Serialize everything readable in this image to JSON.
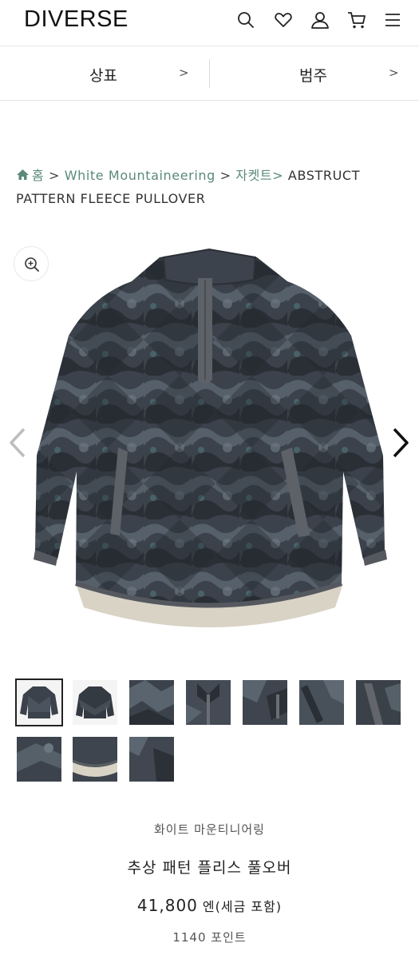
{
  "header": {
    "logo": "DIVERSE",
    "icons": [
      "search-icon",
      "heart-icon",
      "user-icon",
      "cart-icon",
      "menu-icon"
    ]
  },
  "category_bar": {
    "items": [
      {
        "label": "상표",
        "arrow": ">"
      },
      {
        "label": "범주",
        "arrow": ">"
      }
    ]
  },
  "breadcrumb": {
    "home": "홈",
    "sep1": ">",
    "brand": "White Mountaineering",
    "sep2": ">",
    "category": "자켓트>",
    "current": "ABSTRUCT PATTERN FLEECE PULLOVER"
  },
  "gallery": {
    "zoom_icon": "zoom-in-icon",
    "prev_icon": "chevron-left-icon",
    "next_icon": "chevron-right-icon",
    "thumbnail_count": 10,
    "active_thumbnail": 1
  },
  "product": {
    "brand": "화이트 마운티니어링",
    "name": "추상 패턴 플리스 풀오버",
    "price": "41,800",
    "price_unit": "엔(세금 포함)",
    "points": "1140 포인트"
  },
  "colors": {
    "accent_link": "#5a8a7a",
    "garment": "#3a4048",
    "lining": "#d9d3c6"
  }
}
